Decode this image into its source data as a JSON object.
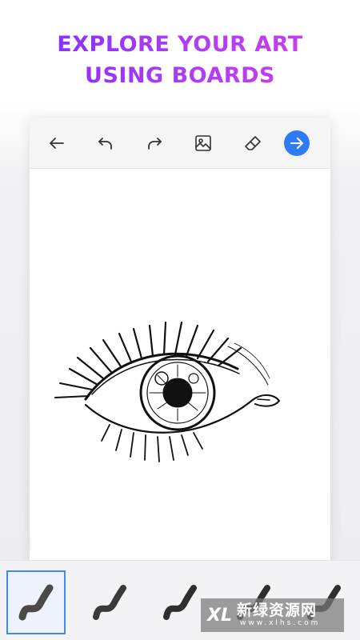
{
  "headline": {
    "line1": "EXPLORE YOUR ART",
    "line2": "USING BOARDS"
  },
  "toolbar": {
    "buttons": [
      {
        "name": "back",
        "icon": "arrow-left-icon"
      },
      {
        "name": "undo",
        "icon": "undo-icon"
      },
      {
        "name": "redo",
        "icon": "redo-icon"
      },
      {
        "name": "image",
        "icon": "image-icon"
      },
      {
        "name": "eraser",
        "icon": "eraser-icon"
      },
      {
        "name": "next",
        "icon": "arrow-right-icon"
      }
    ],
    "accent_color": "#2f7bf5"
  },
  "canvas": {
    "drawing": "eye-sketch"
  },
  "brushes": {
    "items": [
      "brush-1",
      "brush-2",
      "brush-3",
      "brush-4",
      "brush-5"
    ],
    "selected_index": 0,
    "selected_color": "#3d8bf6"
  },
  "watermark": {
    "logo": "XL",
    "text": "新绿资源网",
    "url": "www.xlhs.com"
  }
}
